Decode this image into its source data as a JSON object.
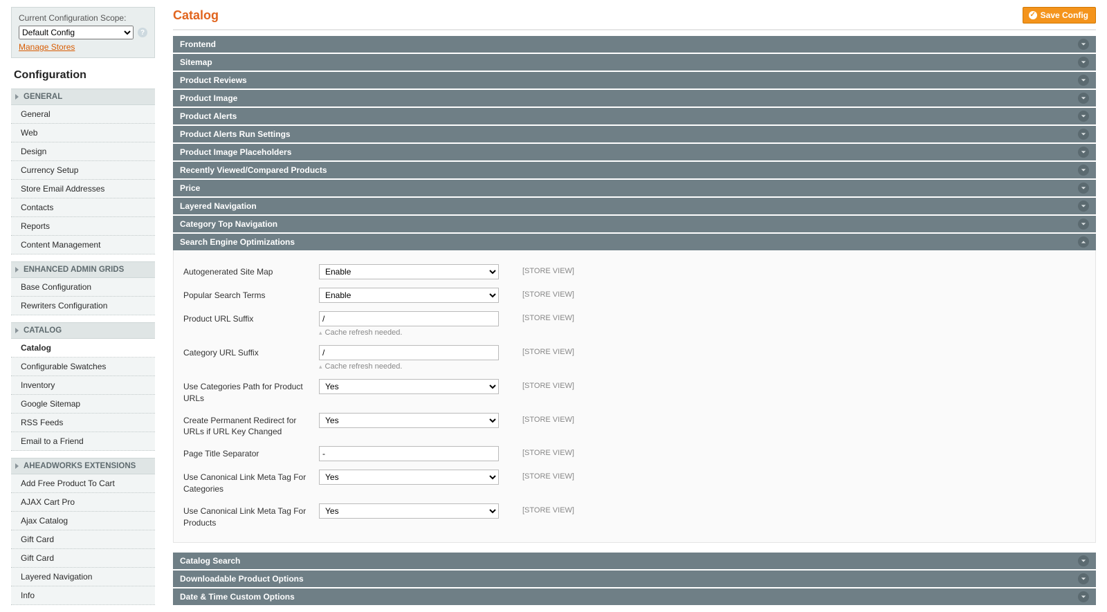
{
  "sidebar": {
    "scope_label": "Current Configuration Scope:",
    "scope_value": "Default Config",
    "manage_stores": "Manage Stores",
    "config_title": "Configuration",
    "groups": [
      {
        "title": "GENERAL",
        "items": [
          "General",
          "Web",
          "Design",
          "Currency Setup",
          "Store Email Addresses",
          "Contacts",
          "Reports",
          "Content Management"
        ]
      },
      {
        "title": "ENHANCED ADMIN GRIDS",
        "items": [
          "Base Configuration",
          "Rewriters Configuration"
        ]
      },
      {
        "title": "CATALOG",
        "items": [
          "Catalog",
          "Configurable Swatches",
          "Inventory",
          "Google Sitemap",
          "RSS Feeds",
          "Email to a Friend"
        ],
        "active_index": 0
      },
      {
        "title": "AHEADWORKS EXTENSIONS",
        "items": [
          "Add Free Product To Cart",
          "AJAX Cart Pro",
          "Ajax Catalog",
          "Gift Card",
          "Gift Card",
          "Layered Navigation",
          "Info"
        ]
      }
    ]
  },
  "main": {
    "title": "Catalog",
    "save_label": "Save Config",
    "scope_text": "[STORE VIEW]",
    "cache_note": "Cache refresh needed.",
    "sections": [
      {
        "label": "Frontend"
      },
      {
        "label": "Sitemap"
      },
      {
        "label": "Product Reviews"
      },
      {
        "label": "Product Image"
      },
      {
        "label": "Product Alerts"
      },
      {
        "label": "Product Alerts Run Settings"
      },
      {
        "label": "Product Image Placeholders"
      },
      {
        "label": "Recently Viewed/Compared Products"
      },
      {
        "label": "Price"
      },
      {
        "label": "Layered Navigation"
      },
      {
        "label": "Category Top Navigation"
      },
      {
        "label": "Search Engine Optimizations",
        "open": true
      }
    ],
    "seo_fields": {
      "autogen_sitemap": {
        "label": "Autogenerated Site Map",
        "value": "Enable"
      },
      "popular_search": {
        "label": "Popular Search Terms",
        "value": "Enable"
      },
      "product_url_suffix": {
        "label": "Product URL Suffix",
        "value": "/"
      },
      "category_url_suffix": {
        "label": "Category URL Suffix",
        "value": "/"
      },
      "use_categories_path": {
        "label": "Use Categories Path for Product URLs",
        "value": "Yes"
      },
      "permanent_redirect": {
        "label": "Create Permanent Redirect for URLs if URL Key Changed",
        "value": "Yes"
      },
      "title_separator": {
        "label": "Page Title Separator",
        "value": "-"
      },
      "canonical_categories": {
        "label": "Use Canonical Link Meta Tag For Categories",
        "value": "Yes"
      },
      "canonical_products": {
        "label": "Use Canonical Link Meta Tag For Products",
        "value": "Yes"
      }
    },
    "sections_after": [
      {
        "label": "Catalog Search"
      },
      {
        "label": "Downloadable Product Options"
      },
      {
        "label": "Date & Time Custom Options"
      }
    ]
  }
}
